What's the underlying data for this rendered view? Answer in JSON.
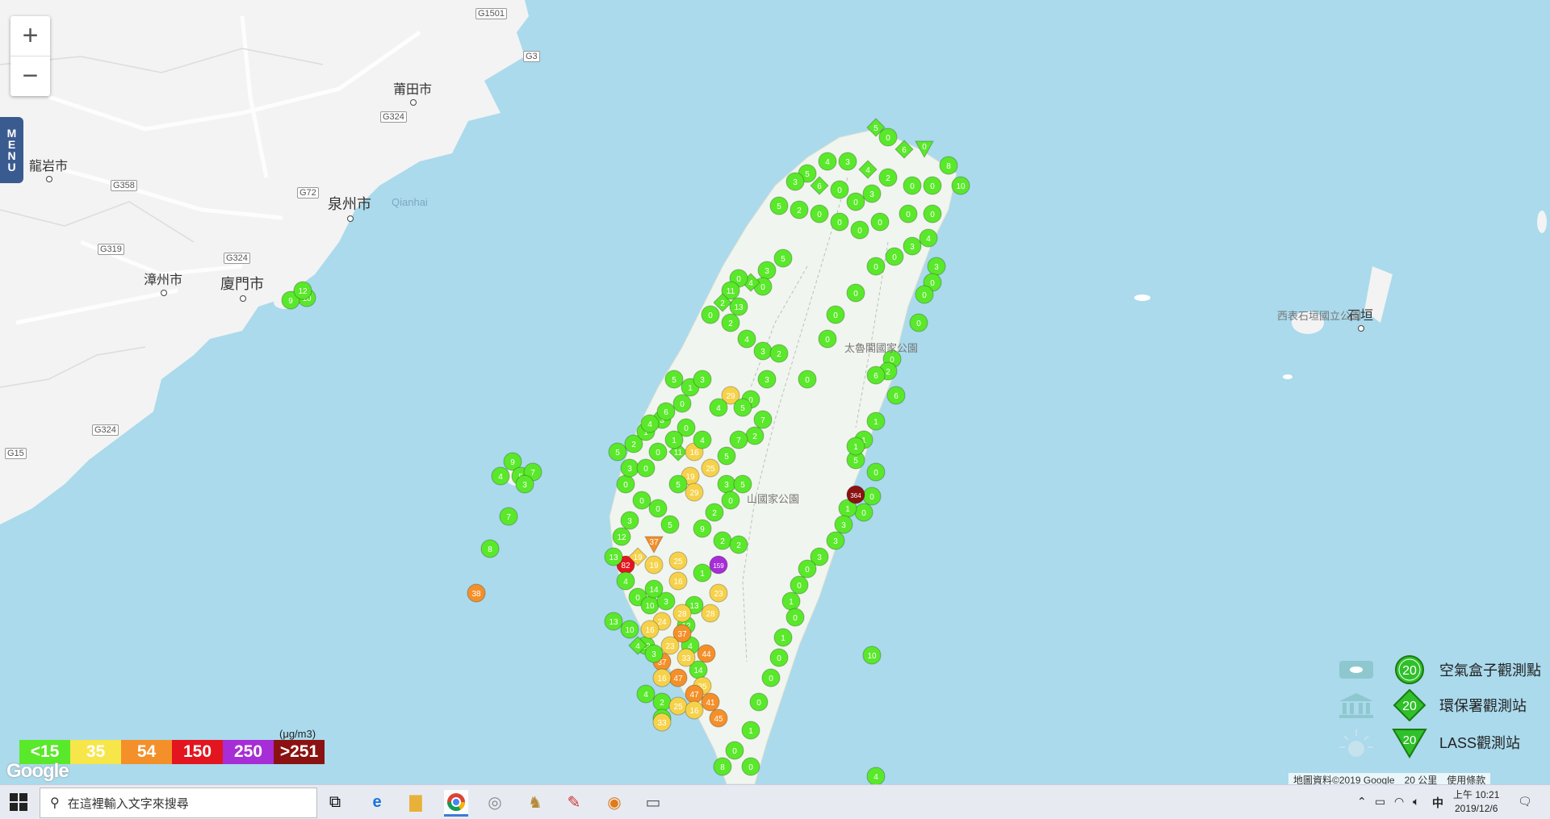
{
  "zoom": {
    "in_label": "+",
    "out_label": "−"
  },
  "menu": {
    "label": "MENU",
    "letters": [
      "M",
      "E",
      "N",
      "U"
    ]
  },
  "labels": {
    "cities": [
      "莆田市",
      "龍岩市",
      "泉州市",
      "漳州市",
      "廈門市",
      "石垣"
    ],
    "places": [
      "Qianhai",
      "太魯閣國家公園",
      "山國家公園",
      "西表石垣國立公園"
    ],
    "roads": [
      "G1501",
      "G3",
      "G324",
      "G358",
      "G72",
      "G319",
      "G324",
      "G324",
      "G15"
    ]
  },
  "colors": {
    "good": "#5ae82b",
    "moderate": "#f6d24a",
    "usg": "#f4902a",
    "unhealthy": "#e3151e",
    "very_unhealthy": "#a72dd6",
    "hazardous": "#8b1212",
    "water": "#aadaec",
    "land": "#f3f3f3",
    "taiwan_land": "#f1f5ef"
  },
  "legend": {
    "unit": "(μg/m3)",
    "scale": [
      {
        "label": "<15",
        "color": "#5ae82b"
      },
      {
        "label": "35",
        "color": "#f6e64a"
      },
      {
        "label": "54",
        "color": "#f4902a"
      },
      {
        "label": "150",
        "color": "#e3151e"
      },
      {
        "label": "250",
        "color": "#a72dd6"
      },
      {
        "label": ">251",
        "color": "#8b1212"
      }
    ],
    "types": [
      {
        "label": "空氣盒子觀測點",
        "symbol": "circle",
        "value": "20"
      },
      {
        "label": "環保署觀測站",
        "symbol": "diamond",
        "value": "20"
      },
      {
        "label": "LASS觀測站",
        "symbol": "triangle",
        "value": "20"
      }
    ]
  },
  "google_logo": "Google",
  "attribution": {
    "data": "地圖資料©2019 Google",
    "scale": "20 公里",
    "terms": "使用條款"
  },
  "markers": [
    {
      "v": "0",
      "c": "good"
    },
    {
      "v": "10",
      "c": "good"
    },
    {
      "v": "8",
      "c": "good"
    },
    {
      "v": "5",
      "c": "good"
    },
    {
      "v": "4",
      "c": "good"
    },
    {
      "v": "3",
      "c": "good"
    },
    {
      "v": "2",
      "c": "good"
    },
    {
      "v": "1",
      "c": "good"
    },
    {
      "v": "6",
      "c": "good"
    },
    {
      "v": "7",
      "c": "good"
    },
    {
      "v": "9",
      "c": "good"
    },
    {
      "v": "11",
      "c": "good"
    },
    {
      "v": "13",
      "c": "good"
    },
    {
      "v": "14",
      "c": "good"
    },
    {
      "v": "12",
      "c": "good"
    },
    {
      "v": "29",
      "c": "moderate"
    },
    {
      "v": "25",
      "c": "moderate"
    },
    {
      "v": "28",
      "c": "moderate"
    },
    {
      "v": "33",
      "c": "moderate"
    },
    {
      "v": "35",
      "c": "moderate"
    },
    {
      "v": "23",
      "c": "moderate"
    },
    {
      "v": "19",
      "c": "moderate"
    },
    {
      "v": "16",
      "c": "moderate"
    },
    {
      "v": "24",
      "c": "moderate"
    },
    {
      "v": "38",
      "c": "usg"
    },
    {
      "v": "37",
      "c": "usg"
    },
    {
      "v": "41",
      "c": "usg"
    },
    {
      "v": "44",
      "c": "usg"
    },
    {
      "v": "47",
      "c": "usg"
    },
    {
      "v": "45",
      "c": "usg"
    },
    {
      "v": "82",
      "c": "unhealthy"
    },
    {
      "v": "159",
      "c": "very_unhealthy"
    },
    {
      "v": "364",
      "c": "hazardous"
    }
  ],
  "taskbar": {
    "search_placeholder": "在這裡輸入文字來搜尋",
    "ime": "中",
    "time": "上午 10:21",
    "date": "2019/12/6"
  }
}
